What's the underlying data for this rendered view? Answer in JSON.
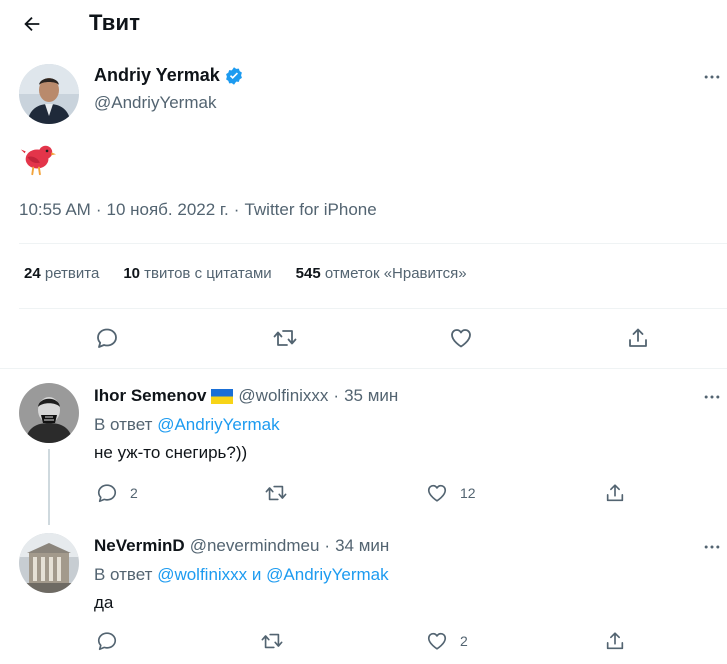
{
  "header": {
    "title": "Твит"
  },
  "main_tweet": {
    "author_name": "Andriy Yermak",
    "author_handle": "@AndriyYermak",
    "content_emoji": "🐦",
    "time": "10:55 AM",
    "date": "10 нояб. 2022 г.",
    "source": "Twitter for iPhone",
    "sep": "·",
    "stats": [
      {
        "count": "24",
        "label": "ретвита"
      },
      {
        "count": "10",
        "label": "твитов с цитатами"
      },
      {
        "count": "545",
        "label": "отметок «Нравится»"
      }
    ]
  },
  "replies": [
    {
      "author_name": "Ihor Semenov",
      "flag": "🇺🇦",
      "author_handle": "@wolfinixxx",
      "sep": "·",
      "time_ago": "35 мин",
      "reply_prefix": "В ответ",
      "reply_to_1": "@AndriyYermak",
      "reply_joiner": "",
      "reply_to_2": "",
      "text": "не уж-то снегирь?))",
      "reply_count": "2",
      "retweet_count": "",
      "like_count": "12"
    },
    {
      "author_name": "NeVerminD",
      "author_handle": "@nevermindmeu",
      "sep": "·",
      "time_ago": "34 мин",
      "reply_prefix": "В ответ",
      "reply_to_1": "@wolfinixxx",
      "reply_joiner": "и",
      "reply_to_2": "@AndriyYermak",
      "text": "да",
      "reply_count": "",
      "retweet_count": "",
      "like_count": "2"
    }
  ],
  "colors": {
    "accent": "#1d9bf0",
    "muted": "#536471",
    "divider": "#eff3f4",
    "verified": "#1d9bf0"
  },
  "icons": [
    "back-arrow-icon",
    "verified-badge-icon",
    "more-icon",
    "reply-icon",
    "retweet-icon",
    "like-icon",
    "share-icon"
  ]
}
